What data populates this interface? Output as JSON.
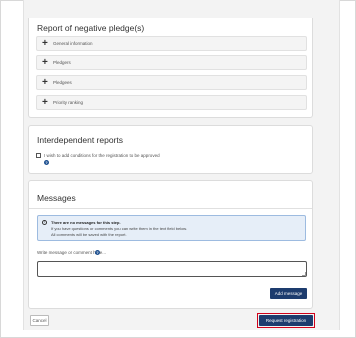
{
  "report_section": {
    "title": "Report of negative pledge(s)",
    "items": [
      {
        "label": "General information"
      },
      {
        "label": "Pledgers"
      },
      {
        "label": "Pledgees"
      },
      {
        "label": "Priority ranking"
      }
    ]
  },
  "interdependent": {
    "title": "Interdependent reports",
    "checkbox_label": "I wish to add conditions for the registration to be approved",
    "checked": false
  },
  "messages": {
    "title": "Messages",
    "info": {
      "title": "There are no messages for this step.",
      "line1": "If you have questions or comments you can write them in the text field below.",
      "line2": "All comments will be saved with the report."
    },
    "input_label": "Write message or comment here...",
    "textarea_value": "",
    "add_button": "Add message"
  },
  "footer": {
    "cancel": "Cancel",
    "request": "Request registration"
  },
  "colors": {
    "primary": "#1d3c6e",
    "highlight": "#d0021b",
    "info_bg": "#e6eef8"
  },
  "icons": {
    "accordion": "plus-icon",
    "help": "question-circle-icon",
    "info": "info-circle-icon"
  }
}
